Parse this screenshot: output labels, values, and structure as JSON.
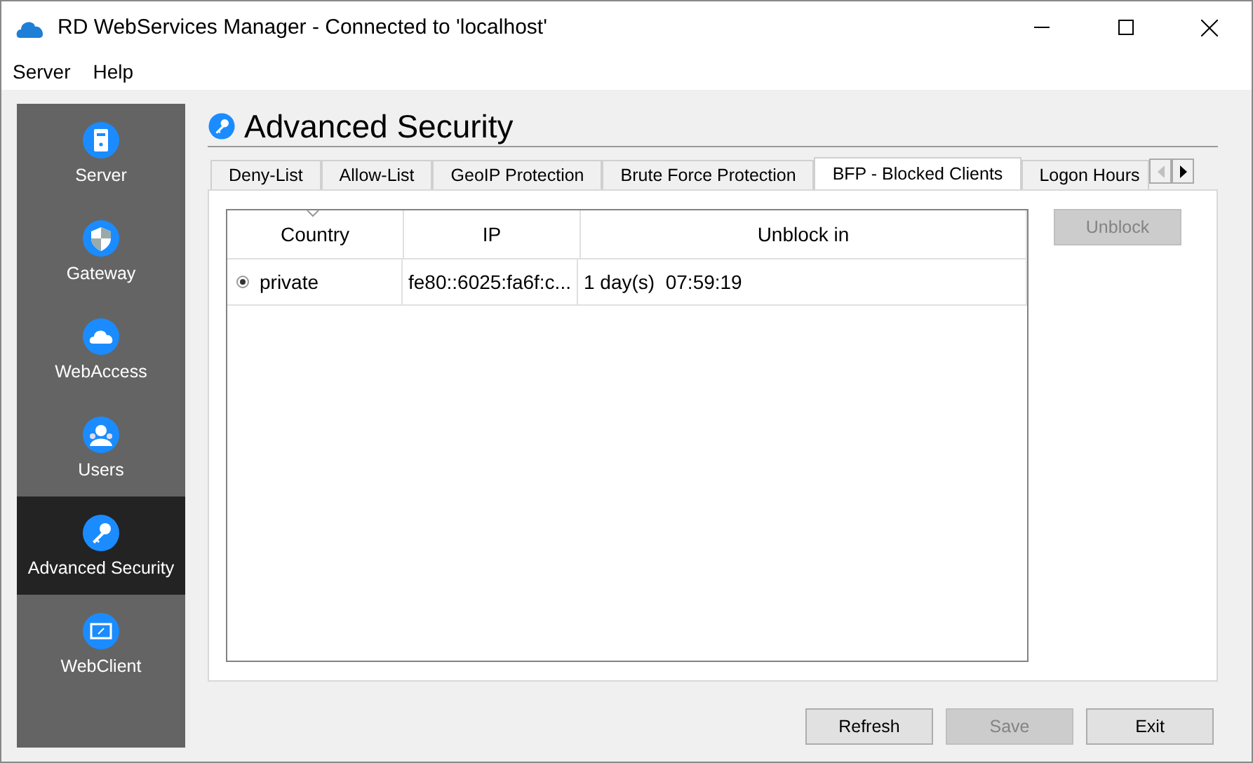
{
  "window": {
    "title": "RD WebServices Manager - Connected to 'localhost'"
  },
  "menu": [
    "Server",
    "Help"
  ],
  "sidebar": {
    "items": [
      {
        "label": "Server",
        "kind": "server",
        "selected": false
      },
      {
        "label": "Gateway",
        "kind": "shield",
        "selected": false
      },
      {
        "label": "WebAccess",
        "kind": "cloud",
        "selected": false
      },
      {
        "label": "Users",
        "kind": "users",
        "selected": false
      },
      {
        "label": "Advanced Security",
        "kind": "key",
        "selected": true
      },
      {
        "label": "WebClient",
        "kind": "monitor",
        "selected": false
      }
    ]
  },
  "page_title": "Advanced Security",
  "tabs": [
    {
      "label": "Deny-List",
      "selected": false
    },
    {
      "label": "Allow-List",
      "selected": false
    },
    {
      "label": "GeoIP Protection",
      "selected": false
    },
    {
      "label": "Brute Force Protection",
      "selected": false
    },
    {
      "label": "BFP - Blocked Clients",
      "selected": true
    },
    {
      "label": "Logon Hours",
      "selected": false
    }
  ],
  "tab_scroll": {
    "left_disabled": true,
    "right_disabled": false
  },
  "table": {
    "columns": [
      {
        "label": "Country",
        "sorted": true
      },
      {
        "label": "IP",
        "sorted": false
      },
      {
        "label": "Unblock in",
        "sorted": false
      }
    ],
    "rows": [
      {
        "cells": [
          "private",
          "fe80::6025:fa6f:c...",
          "1 day(s)  07:59:19"
        ],
        "selected": true
      }
    ]
  },
  "side_buttons": [
    {
      "label": "Unblock",
      "disabled": true
    }
  ],
  "buttons": [
    {
      "label": "Refresh",
      "disabled": false
    },
    {
      "label": "Save",
      "disabled": true
    },
    {
      "label": "Exit",
      "disabled": false
    }
  ]
}
